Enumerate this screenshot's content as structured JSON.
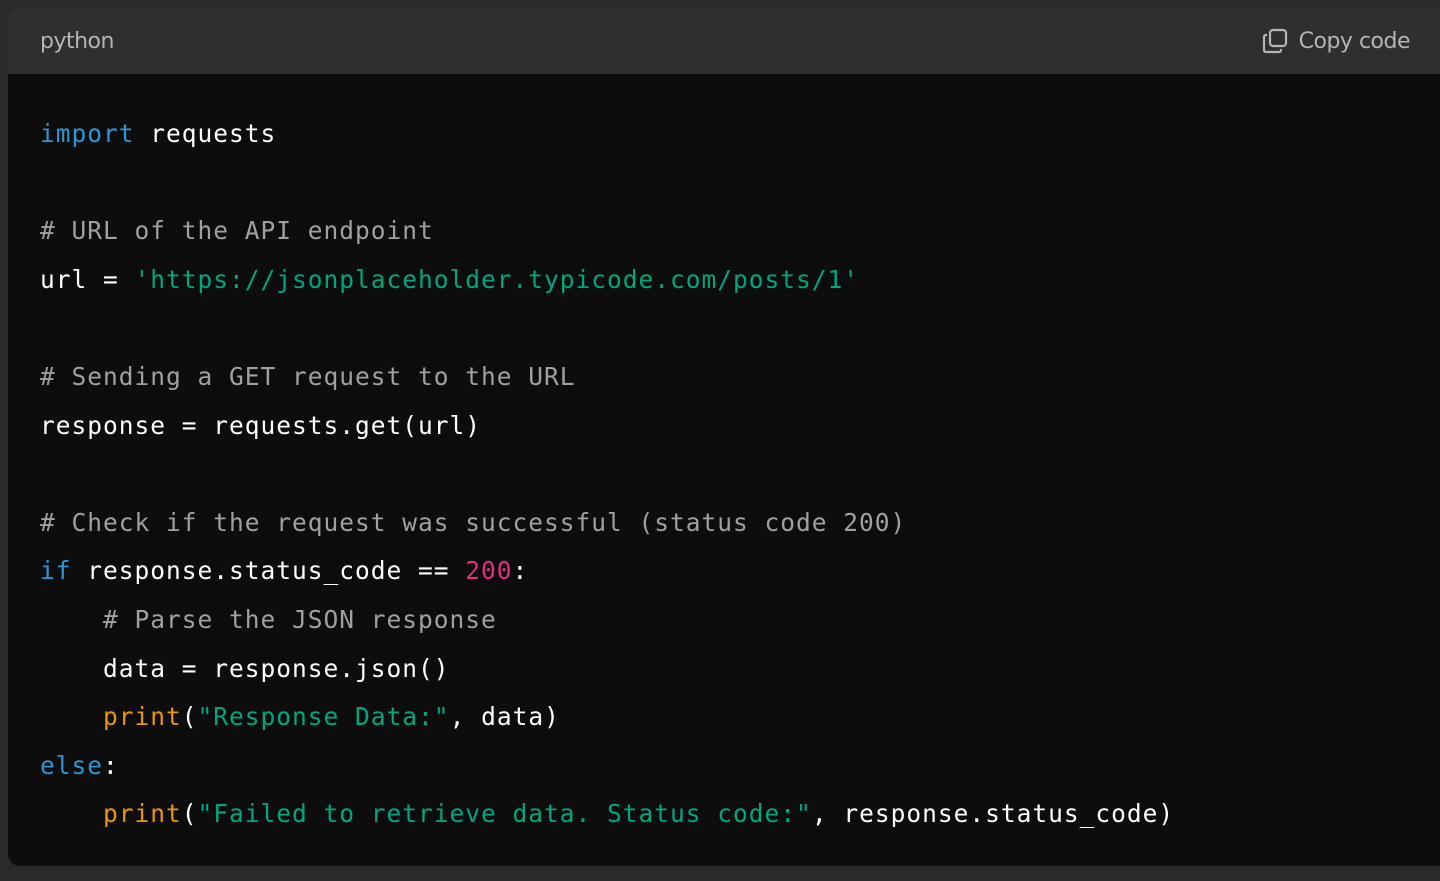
{
  "header": {
    "language": "python",
    "copy_label": "Copy code"
  },
  "colors": {
    "background": "#0d0d0d",
    "header_background": "#2f2f2f",
    "keyword": "#2e95d3",
    "comment": "#a0a0a0",
    "string": "#00a67d",
    "number": "#df3079",
    "builtin": "#e9950c",
    "plain": "#ffffff"
  },
  "icons": {
    "copy": "copy-icon"
  },
  "code": {
    "lines": [
      [
        {
          "t": "keyword",
          "v": "import"
        },
        {
          "t": "plain",
          "v": " requests"
        }
      ],
      [],
      [
        {
          "t": "comment",
          "v": "# URL of the API endpoint"
        }
      ],
      [
        {
          "t": "plain",
          "v": "url = "
        },
        {
          "t": "string",
          "v": "'https://jsonplaceholder.typicode.com/posts/1'"
        }
      ],
      [],
      [
        {
          "t": "comment",
          "v": "# Sending a GET request to the URL"
        }
      ],
      [
        {
          "t": "plain",
          "v": "response = requests.get(url)"
        }
      ],
      [],
      [
        {
          "t": "comment",
          "v": "# Check if the request was successful (status code 200)"
        }
      ],
      [
        {
          "t": "keyword",
          "v": "if"
        },
        {
          "t": "plain",
          "v": " response.status_code == "
        },
        {
          "t": "number",
          "v": "200"
        },
        {
          "t": "plain",
          "v": ":"
        }
      ],
      [
        {
          "t": "plain",
          "v": "    "
        },
        {
          "t": "comment",
          "v": "# Parse the JSON response"
        }
      ],
      [
        {
          "t": "plain",
          "v": "    data = response.json()"
        }
      ],
      [
        {
          "t": "plain",
          "v": "    "
        },
        {
          "t": "builtin",
          "v": "print"
        },
        {
          "t": "plain",
          "v": "("
        },
        {
          "t": "string",
          "v": "\"Response Data:\""
        },
        {
          "t": "plain",
          "v": ", data)"
        }
      ],
      [
        {
          "t": "keyword",
          "v": "else"
        },
        {
          "t": "plain",
          "v": ":"
        }
      ],
      [
        {
          "t": "plain",
          "v": "    "
        },
        {
          "t": "builtin",
          "v": "print"
        },
        {
          "t": "plain",
          "v": "("
        },
        {
          "t": "string",
          "v": "\"Failed to retrieve data. Status code:\""
        },
        {
          "t": "plain",
          "v": ", response.status_code)"
        }
      ]
    ]
  }
}
